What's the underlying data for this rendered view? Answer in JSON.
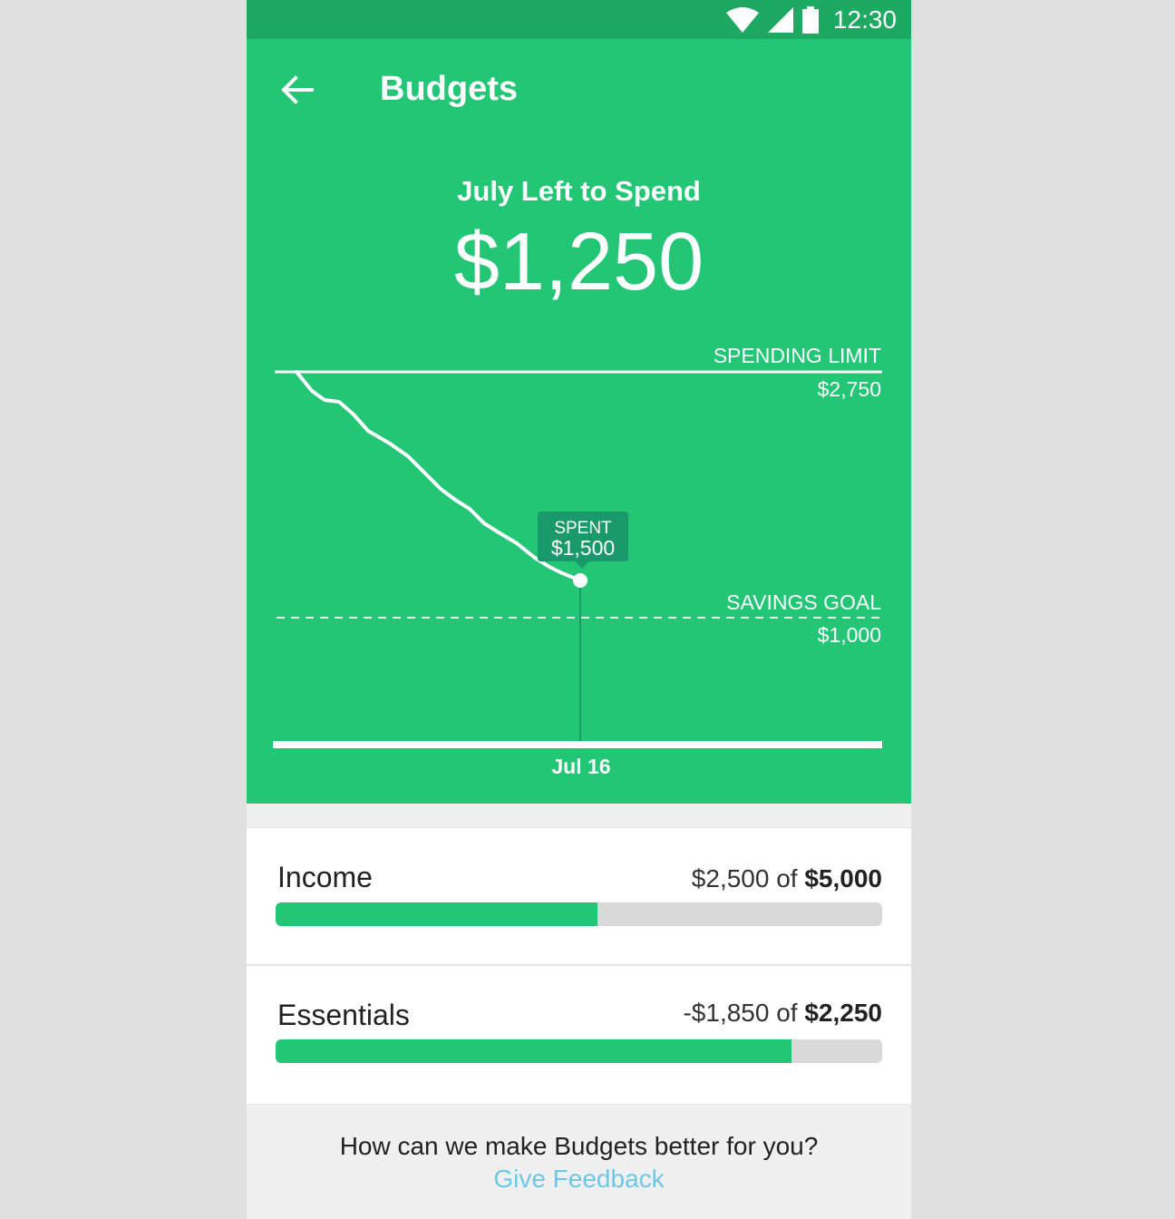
{
  "status_bar": {
    "time": "12:30",
    "icons": [
      "wifi-icon",
      "cellular-signal-icon",
      "battery-icon"
    ]
  },
  "app_bar": {
    "back_icon": "arrow-left-icon",
    "title": "Budgets"
  },
  "hero": {
    "label": "July Left to Spend",
    "amount": "$1,250"
  },
  "chart_data": {
    "type": "line",
    "spending_limit_label": "SPENDING LIMIT",
    "spending_limit_value": "$2,750",
    "savings_goal_label": "SAVINGS GOAL",
    "savings_goal_value": "$1,000",
    "spent_label": "SPENT",
    "spent_value": "$1,500",
    "x_label": "Jul 16"
  },
  "income": {
    "title": "Income",
    "current": "$2,500",
    "of": "of",
    "total": "$5,000",
    "progress": 0.53
  },
  "essentials": {
    "title": "Essentials",
    "current": "-$1,850",
    "of": "of",
    "total": "$2,250",
    "progress": 0.85
  },
  "feedback": {
    "question": "How can we make Budgets better for you?",
    "link": "Give Feedback"
  },
  "colors": {
    "primary": "#22c675",
    "primary_dark": "#1ea963",
    "tooltip": "#1a9a6b",
    "link": "#6dc8e8",
    "track": "#d9d9d9"
  }
}
